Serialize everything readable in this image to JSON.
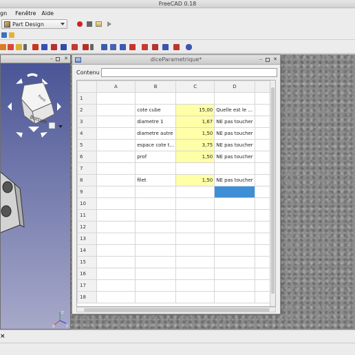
{
  "window": {
    "title": "FreeCAD 0.18"
  },
  "menu": {
    "items": [
      "gn",
      "Fenêtre",
      "Aide"
    ]
  },
  "toolbar": {
    "workbench": "Part Design"
  },
  "view3d": {
    "cube_faces": [
      "Front",
      "Bottom"
    ]
  },
  "sheet": {
    "title": "diceParametrique*",
    "contenu_label": "Contenu",
    "contenu_value": "",
    "columns": [
      "A",
      "B",
      "C",
      "D"
    ],
    "rows": [
      {
        "n": "1",
        "B": "",
        "C": "",
        "D": ""
      },
      {
        "n": "2",
        "B": "cote cube",
        "C": "15,00",
        "D": "Quelle est le ..."
      },
      {
        "n": "3",
        "B": "diametre 1",
        "C": "1,67",
        "D": "NE pas toucher"
      },
      {
        "n": "4",
        "B": "diametre autre",
        "C": "1,50",
        "D": "NE pas toucher"
      },
      {
        "n": "5",
        "B": "espace cote t...",
        "C": "3,75",
        "D": "NE pas toucher"
      },
      {
        "n": "6",
        "B": "prof",
        "C": "1,50",
        "D": "NE pas toucher"
      },
      {
        "n": "7",
        "B": "",
        "C": "",
        "D": ""
      },
      {
        "n": "8",
        "B": "filet",
        "C": "1,50",
        "D": "NE pas toucher"
      },
      {
        "n": "9",
        "B": "",
        "C": "",
        "D": ""
      },
      {
        "n": "10",
        "B": "",
        "C": "",
        "D": ""
      },
      {
        "n": "11",
        "B": "",
        "C": "",
        "D": ""
      },
      {
        "n": "12",
        "B": "",
        "C": "",
        "D": ""
      },
      {
        "n": "13",
        "B": "",
        "C": "",
        "D": ""
      },
      {
        "n": "14",
        "B": "",
        "C": "",
        "D": ""
      },
      {
        "n": "15",
        "B": "",
        "C": "",
        "D": ""
      },
      {
        "n": "16",
        "B": "",
        "C": "",
        "D": ""
      },
      {
        "n": "17",
        "B": "",
        "C": "",
        "D": ""
      },
      {
        "n": "18",
        "B": "",
        "C": "",
        "D": ""
      }
    ]
  },
  "bottom": {
    "close_glyph": "×"
  },
  "colors": {
    "highlight": "#ffffa8",
    "selection": "#3f8fd6",
    "view_top": "#4a5596",
    "view_bottom": "#a7a9c9"
  }
}
